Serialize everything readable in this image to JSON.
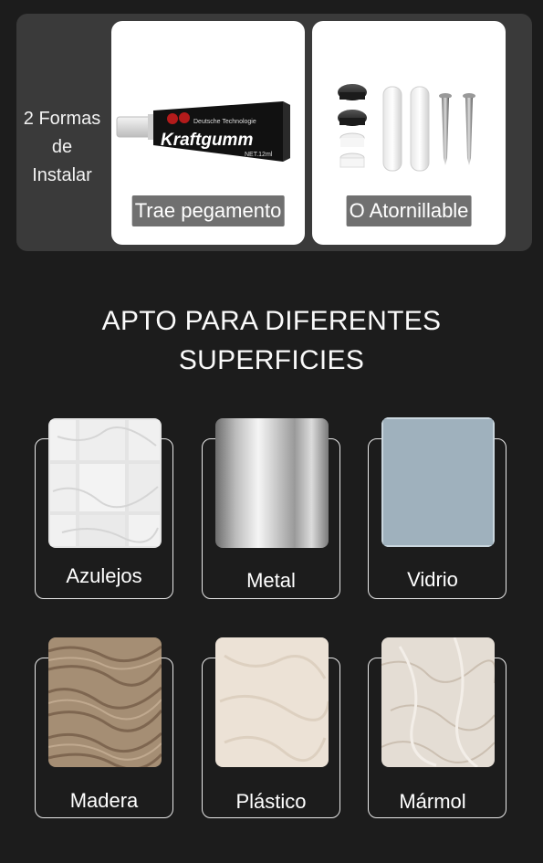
{
  "install": {
    "label_lines": [
      "2 Formas",
      "de",
      "Instalar"
    ],
    "glue_caption": "Trae pegamento",
    "screw_caption": "O Atornillable",
    "tube": {
      "brand": "Kraftgumm",
      "maker": "Deutsche Technologie",
      "net": "NET.12ml"
    }
  },
  "section": {
    "title_lines": [
      "APTO PARA DIFERENTES",
      "SUPERFICIES"
    ]
  },
  "surfaces": [
    {
      "label": "Azulejos"
    },
    {
      "label": "Metal"
    },
    {
      "label": "Vidrio"
    },
    {
      "label": "Madera"
    },
    {
      "label": "Plástico"
    },
    {
      "label": "Mármol"
    }
  ]
}
